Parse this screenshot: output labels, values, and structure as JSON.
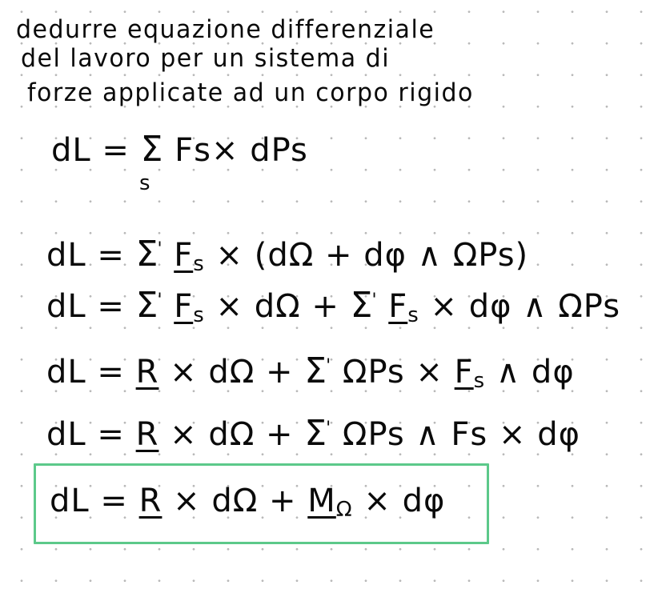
{
  "title": {
    "lines": [
      "dedurre equazione differenziale",
      "del lavoro per un sistema di",
      "forze applicate ad un corpo rigido"
    ]
  },
  "equations": {
    "eq1": {
      "lhs": "dL =",
      "sigma": "Σ",
      "sum_index": "s",
      "rhs": "Fs× dPs"
    },
    "eq2": {
      "lhs": "dL =",
      "sigma": "Σ",
      "prime": "'",
      "F": "F",
      "F_sub": "s",
      "rest": "× (dΩ + dφ ∧ ΩPs)"
    },
    "eq3": {
      "lhs": "dL =",
      "sigma": "Σ",
      "prime": "'",
      "F": "F",
      "F_sub": "s",
      "mid": "× dΩ +",
      "sigma2": "Σ",
      "prime2": "'",
      "F2": "F",
      "F2_sub": "s",
      "rest": "× dφ ∧ ΩPs"
    },
    "eq4": {
      "lhs": "dL =",
      "R": "R",
      "mid": "× dΩ +",
      "sigma": "Σ",
      "prime": "'",
      "term": "ΩPs ×",
      "F": "F",
      "F_sub": "s",
      "rest": "∧ dφ"
    },
    "eq5": {
      "lhs": "dL =",
      "R": "R",
      "mid": "× dΩ +",
      "sigma": "Σ",
      "prime": "'",
      "rest": "ΩPs ∧ Fs × dφ"
    },
    "result": {
      "lhs": "dL =",
      "R": "R",
      "mid": "× dΩ +",
      "M": "M",
      "M_sub": "Ω",
      "rest": "× dφ"
    }
  },
  "colors": {
    "ink": "#0a0a0a",
    "highlight_box": "#5cc98a",
    "grid_dots": "#b9b9b9"
  }
}
